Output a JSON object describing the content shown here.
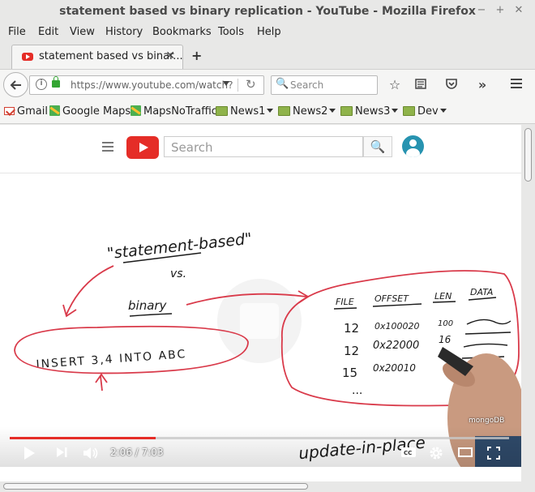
{
  "window": {
    "title": "statement based vs binary replication - YouTube - Mozilla Firefox",
    "controls": [
      "−",
      "+",
      "✕"
    ]
  },
  "menu": {
    "items": [
      "File",
      "Edit",
      "View",
      "History",
      "Bookmarks",
      "Tools",
      "Help"
    ]
  },
  "tabs": [
    {
      "label": "statement based vs binar...",
      "active": true
    }
  ],
  "newtab_label": "+",
  "navbar": {
    "url": "https://www.youtube.com/watch?",
    "search_placeholder": "Search"
  },
  "bookmarks": {
    "items": [
      {
        "label": "Gmail",
        "icon": "gmail-icon",
        "dropdown": false
      },
      {
        "label": "Google Maps",
        "icon": "maps-icon",
        "dropdown": false
      },
      {
        "label": "MapsNoTraffic",
        "icon": "maps-icon",
        "dropdown": false
      },
      {
        "label": "News1",
        "icon": "folder-icon",
        "dropdown": true
      },
      {
        "label": "News2",
        "icon": "folder-icon",
        "dropdown": true
      },
      {
        "label": "News3",
        "icon": "folder-icon",
        "dropdown": true
      },
      {
        "label": "Dev",
        "icon": "folder-icon",
        "dropdown": true
      }
    ]
  },
  "youtube": {
    "search_placeholder": "Search"
  },
  "video": {
    "progress": 0.293,
    "current_time": "2:06",
    "duration": "7:03",
    "time_separator": " / ",
    "watermark": "mongoDB",
    "whiteboard": {
      "title_line1": "\"statement-based\"",
      "vs": "vs.",
      "binary": "binary",
      "statement": "INSERT 3,4  INTO ABC",
      "table_headers": [
        "FILE",
        "OFFSET",
        "LEN",
        "DATA"
      ],
      "rows": [
        [
          "12",
          "0x100020",
          "100"
        ],
        [
          "12",
          "0x22000",
          "16"
        ],
        [
          "15",
          "0x20010",
          ""
        ]
      ],
      "ellipsis": "...",
      "caption": "update-in-place"
    }
  },
  "colors": {
    "brand_red": "#e52d27",
    "ink": "#1a1a1a",
    "marker_red": "#d93a4a"
  }
}
